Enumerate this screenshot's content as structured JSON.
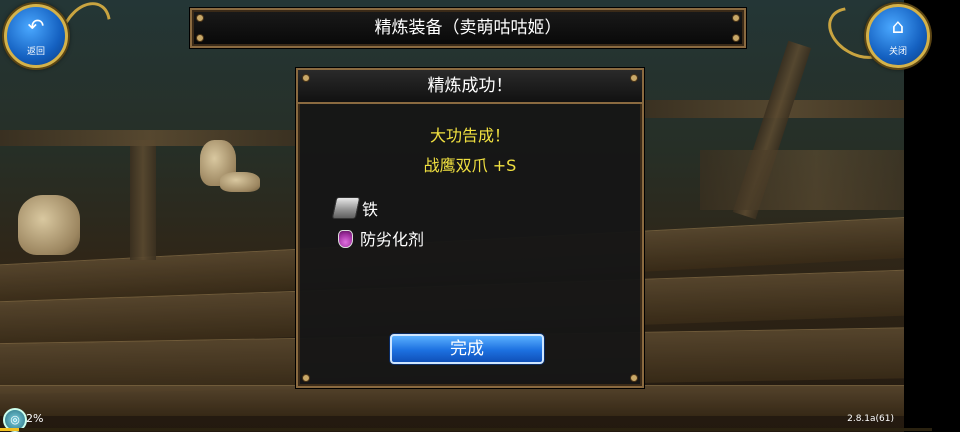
{
  "header": {
    "title": "精炼装备（卖萌咕咕姬）",
    "back_label": "返回",
    "close_label": "关闭"
  },
  "dialog": {
    "title": "精炼成功！",
    "message_line1": "大功告成！",
    "message_line2": "战鹰双爪 +S",
    "materials": [
      {
        "label": "铁",
        "icon": "iron-ingot-icon"
      },
      {
        "label": "防劣化剂",
        "icon": "potion-flask-icon"
      }
    ],
    "done_label": "完成"
  },
  "status": {
    "progress_text": "2%",
    "progress_fraction": 0.02,
    "version": "2.8.1a(61)"
  },
  "colors": {
    "message": "#f0e040",
    "frame": "#8a6a40",
    "button": "#1c70e0"
  }
}
